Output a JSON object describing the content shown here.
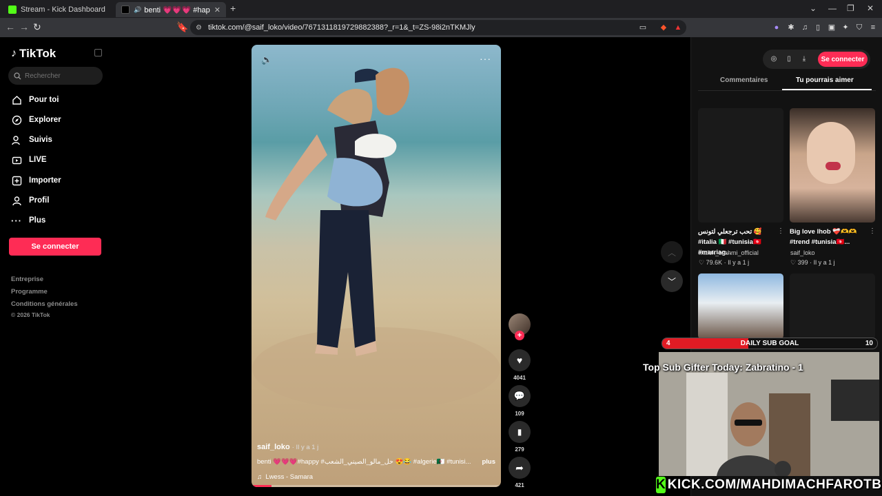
{
  "browser": {
    "tabs": [
      {
        "title": "Stream - Kick Dashboard",
        "favicon_color": "#53fc18"
      },
      {
        "title": "benti 💗💗💗 #happy #حل...",
        "favicon_color": "#000000"
      }
    ],
    "url": "tiktok.com/@saif_loko/video/7671311819729882388?_r=1&_t=ZS-98i2nTKMJly"
  },
  "sidebar": {
    "brand": "TikTok",
    "search_placeholder": "Rechercher",
    "nav": [
      {
        "label": "Pour toi",
        "icon": "home-icon"
      },
      {
        "label": "Explorer",
        "icon": "compass-icon"
      },
      {
        "label": "Suivis",
        "icon": "following-icon"
      },
      {
        "label": "LIVE",
        "icon": "live-icon"
      },
      {
        "label": "Importer",
        "icon": "upload-icon"
      },
      {
        "label": "Profil",
        "icon": "profile-icon"
      },
      {
        "label": "Plus",
        "icon": "more-icon"
      }
    ],
    "login": "Se connecter",
    "footer": [
      "Entreprise",
      "Programme",
      "Conditions générales",
      "© 2026 TikTok"
    ]
  },
  "video": {
    "author": "saif_loko",
    "age": "· Il y a 1 j",
    "caption": "benti 💗💗💗#happy #حل_مالو_الصيني_الشعب 😍😂 #algerie🇩🇿 #tunisi...",
    "more": "plus",
    "music": "Lwess - Samara",
    "progress": 0.08
  },
  "actions": {
    "likes": "4041",
    "comments": "109",
    "saves": "279",
    "shares": "421"
  },
  "right_panel": {
    "login": "Se connecter",
    "tabs": [
      "Commentaires",
      "Tu pourrais aimer"
    ],
    "active_tab": 1,
    "cards": [
      {
        "caption": "تحب ترجعلي لتونس 🥰 #italia 🇮🇹 #tunisia🇹🇳 #marriag...",
        "user": "malek_brahmi_official",
        "likes": "♡ 79.6K",
        "age": "· Il y a 1 j"
      },
      {
        "caption": "Big love lhob ❤️‍🩹🫶🫶 #trend #tunisia🇹🇳...",
        "user": "saif_loko",
        "likes": "♡ 399",
        "age": "· Il y a 1 j"
      }
    ]
  },
  "stream": {
    "goal_label": "DAILY SUB GOAL",
    "goal_current": "4",
    "goal_max": "10",
    "goal_fraction": 0.4,
    "gifter": "Top Sub Gifter Today: Zabratino - 1",
    "kick_url": "KICK.COM/MAHDIMACHFAROTB",
    "kick_letter": "K"
  }
}
